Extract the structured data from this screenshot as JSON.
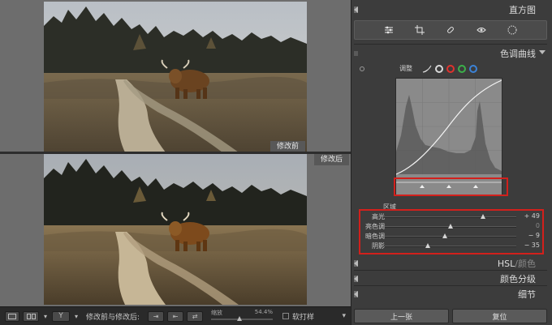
{
  "photo": {
    "before_label": "修改前",
    "after_label": "修改后"
  },
  "toolbar": {
    "compare_label": "修改前与修改后:",
    "zoom_label": "缩放",
    "zoom_value": "54.4%",
    "zoom_fraction": 0.46,
    "softproof_label": "软打样"
  },
  "panel": {
    "histogram_title": "直方图",
    "tone_curve_title": "色调曲线",
    "adjust_label": "调整",
    "region_label": "区域",
    "sliders": [
      {
        "label": "高光",
        "value": "+ 49",
        "fraction": 0.745
      },
      {
        "label": "亮色调",
        "value": "0",
        "fraction": 0.5
      },
      {
        "label": "暗色调",
        "value": "− 9",
        "fraction": 0.455
      },
      {
        "label": "阴影",
        "value": "− 35",
        "fraction": 0.325
      }
    ],
    "hsl_title_a": "HSL",
    "hsl_title_sep": " / ",
    "hsl_title_b": "颜色",
    "split_toning_title": "颜色分级",
    "detail_title": "细节",
    "prev_button": "上一张",
    "reset_button": "复位"
  },
  "colors": {
    "accent_red": "#d2201c",
    "channel_red": "#e0322d",
    "channel_green": "#3bb04a",
    "channel_blue": "#3b82d6"
  }
}
